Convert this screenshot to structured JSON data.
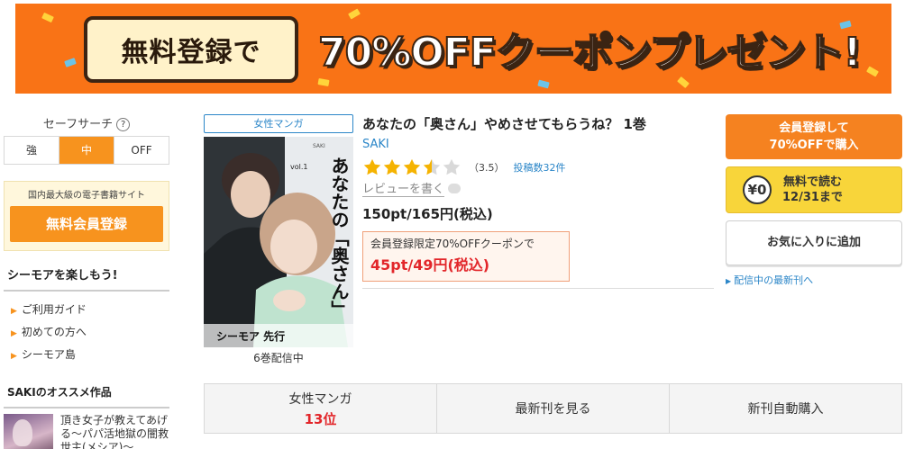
{
  "banner": {
    "lead": "無料登録で",
    "headline": "70%OFFクーポンプレゼント!",
    "bg_color": "#f97316"
  },
  "sidebar": {
    "safe_search_label": "セーフサーチ",
    "help_icon": "?",
    "safe_options": [
      "強",
      "中",
      "OFF"
    ],
    "safe_selected": "中",
    "register_caption": "国内最大級の電子書籍サイト",
    "register_button": "無料会員登録",
    "enjoy_title": "シーモアを楽しもう!",
    "links": [
      "ご利用ガイド",
      "初めての方へ",
      "シーモア島"
    ],
    "recommend_title": "SAKIのオススメ作品",
    "recommend_item": "頂き女子が教えてあげる〜パパ活地獄の闇救世主(メシア)〜"
  },
  "product": {
    "genre_badge": "女性マンガ",
    "title": "あなたの「奥さん」やめさせてもらうね？ 1巻",
    "author": "SAKI",
    "rating_value": 3.5,
    "rating_text": "（3.5）",
    "post_count": "投稿数32件",
    "review_link": "レビューを書く",
    "price": "150pt/165円(税込)",
    "coupon_note": "会員登録限定70%OFFクーポンで",
    "coupon_price": "45pt/49円(税込)",
    "cover_sub": "6巻配信中",
    "cover_art": {
      "title": "あなたの「奥さん」",
      "author": "SAKI",
      "vol": "vol.1",
      "publisher": "シーモア 先行"
    }
  },
  "actions": {
    "buy_line1": "会員登録して",
    "buy_line2": "70%OFFで購入",
    "yen_icon": "¥0",
    "free_line1": "無料で読む",
    "free_line2": "12/31まで",
    "favorite": "お気に入りに追加",
    "latest_link": "配信中の最新刊へ"
  },
  "tabs": {
    "genre": "女性マンガ",
    "rank": "13位",
    "latest": "最新刊を見る",
    "auto_buy": "新刊自動購入"
  },
  "colors": {
    "accent": "#f7931e",
    "link": "#2b86c8",
    "sale_red": "#e2262a",
    "free_yellow": "#f8d53a"
  }
}
